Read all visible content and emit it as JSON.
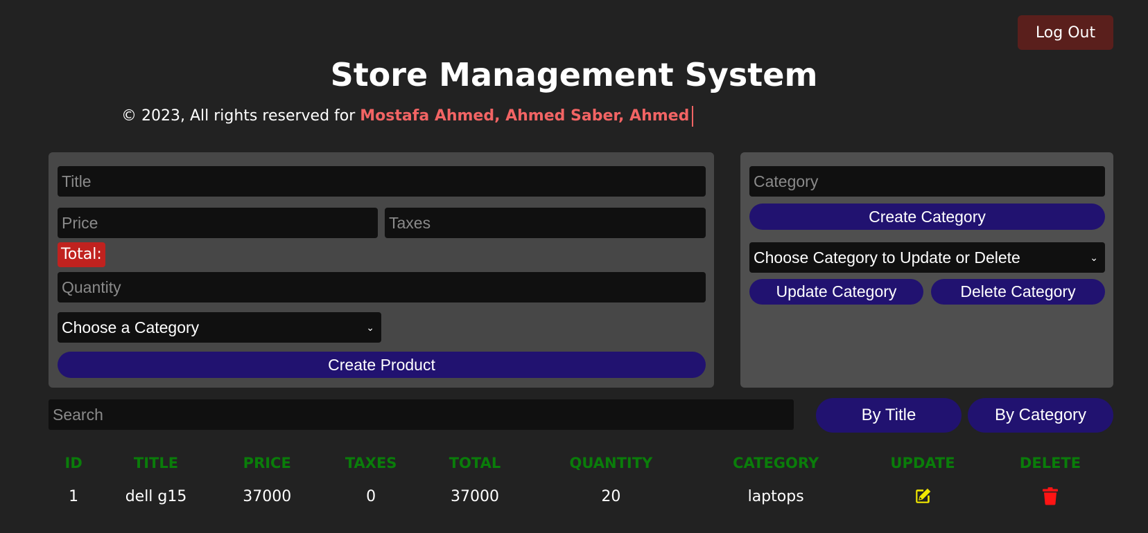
{
  "header": {
    "logout_label": "Log Out",
    "title": "Store Management System",
    "copyright_prefix": "© 2023, All rights reserved for ",
    "copyright_authors": "Mostafa Ahmed, Ahmed Saber, Ahmed"
  },
  "product_form": {
    "title_placeholder": "Title",
    "price_placeholder": "Price",
    "taxes_placeholder": "Taxes",
    "total_label": "Total:",
    "quantity_placeholder": "Quantity",
    "category_select": "Choose a Category",
    "create_label": "Create Product"
  },
  "category_form": {
    "category_placeholder": "Category",
    "create_label": "Create Category",
    "select_label": "Choose Category to Update or Delete",
    "update_label": "Update Category",
    "delete_label": "Delete Category"
  },
  "search": {
    "placeholder": "Search",
    "by_title_label": "By Title",
    "by_category_label": "By Category"
  },
  "table": {
    "headers": [
      "ID",
      "TITLE",
      "PRICE",
      "TAXES",
      "TOTAL",
      "QUANTITY",
      "CATEGORY",
      "UPDATE",
      "DELETE"
    ],
    "rows": [
      {
        "id": "1",
        "title": "dell g15",
        "price": "37000",
        "taxes": "0",
        "total": "37000",
        "quantity": "20",
        "category": "laptops"
      }
    ]
  },
  "colors": {
    "background": "#222222",
    "panel": "#474747",
    "accent_button": "#211270",
    "logout_button": "#5a1f1c",
    "total_badge": "#c0221f",
    "header_green": "#0a7d0a",
    "author_red": "#f26464",
    "update_icon": "#f2e800",
    "delete_icon": "#ff1414"
  },
  "icons": {
    "update": "edit-pencil-icon",
    "delete": "trash-icon",
    "select_arrow": "chevron-down-icon"
  }
}
